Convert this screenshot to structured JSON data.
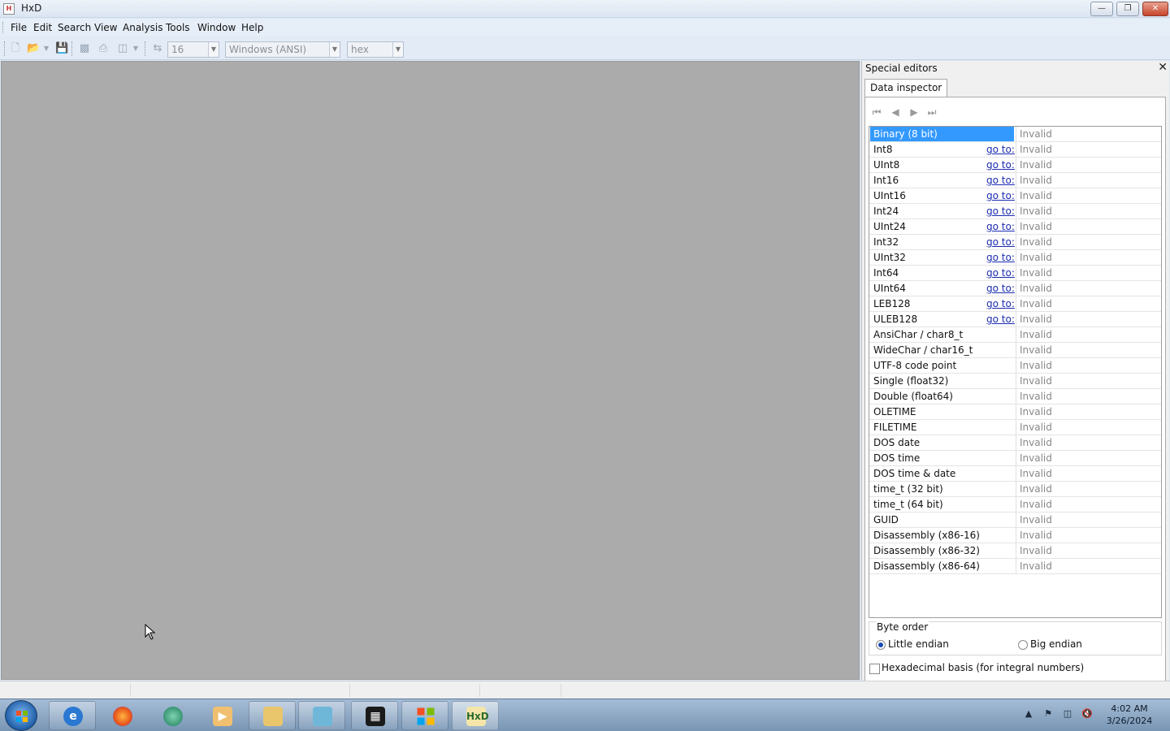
{
  "window": {
    "title": "HxD"
  },
  "menu": [
    "File",
    "Edit",
    "Search",
    "View",
    "Analysis",
    "Tools",
    "Window",
    "Help"
  ],
  "toolbar": {
    "bytes_per_row": "16",
    "charset": "Windows (ANSI)",
    "offset_base": "hex"
  },
  "panel": {
    "title": "Special editors",
    "tab": "Data inspector",
    "goto_label": "go to:",
    "rows": [
      {
        "name": "Binary (8 bit)",
        "value": "Invalid",
        "goto": false
      },
      {
        "name": "Int8",
        "value": "Invalid",
        "goto": true
      },
      {
        "name": "UInt8",
        "value": "Invalid",
        "goto": true
      },
      {
        "name": "Int16",
        "value": "Invalid",
        "goto": true
      },
      {
        "name": "UInt16",
        "value": "Invalid",
        "goto": true
      },
      {
        "name": "Int24",
        "value": "Invalid",
        "goto": true
      },
      {
        "name": "UInt24",
        "value": "Invalid",
        "goto": true
      },
      {
        "name": "Int32",
        "value": "Invalid",
        "goto": true
      },
      {
        "name": "UInt32",
        "value": "Invalid",
        "goto": true
      },
      {
        "name": "Int64",
        "value": "Invalid",
        "goto": true
      },
      {
        "name": "UInt64",
        "value": "Invalid",
        "goto": true
      },
      {
        "name": "LEB128",
        "value": "Invalid",
        "goto": true
      },
      {
        "name": "ULEB128",
        "value": "Invalid",
        "goto": true
      },
      {
        "name": "AnsiChar / char8_t",
        "value": "Invalid",
        "goto": false
      },
      {
        "name": "WideChar / char16_t",
        "value": "Invalid",
        "goto": false
      },
      {
        "name": "UTF-8 code point",
        "value": "Invalid",
        "goto": false
      },
      {
        "name": "Single (float32)",
        "value": "Invalid",
        "goto": false
      },
      {
        "name": "Double (float64)",
        "value": "Invalid",
        "goto": false
      },
      {
        "name": "OLETIME",
        "value": "Invalid",
        "goto": false
      },
      {
        "name": "FILETIME",
        "value": "Invalid",
        "goto": false
      },
      {
        "name": "DOS date",
        "value": "Invalid",
        "goto": false
      },
      {
        "name": "DOS time",
        "value": "Invalid",
        "goto": false
      },
      {
        "name": "DOS time & date",
        "value": "Invalid",
        "goto": false
      },
      {
        "name": "time_t (32 bit)",
        "value": "Invalid",
        "goto": false
      },
      {
        "name": "time_t (64 bit)",
        "value": "Invalid",
        "goto": false
      },
      {
        "name": "GUID",
        "value": "Invalid",
        "goto": false
      },
      {
        "name": "Disassembly (x86-16)",
        "value": "Invalid",
        "goto": false
      },
      {
        "name": "Disassembly (x86-32)",
        "value": "Invalid",
        "goto": false
      },
      {
        "name": "Disassembly (x86-64)",
        "value": "Invalid",
        "goto": false
      }
    ],
    "selected_row": "Binary (8 bit)",
    "byte_order": {
      "legend": "Byte order",
      "little": "Little endian",
      "big": "Big endian",
      "selected": "Little endian"
    },
    "hex_basis": {
      "label": "Hexadecimal basis (for integral numbers)",
      "checked": false
    }
  },
  "taskbar": {
    "apps": [
      "internet-explorer",
      "firefox",
      "chat-app",
      "media-player",
      "file-explorer",
      "notepad",
      "video-editor",
      "windows-app",
      "hxd"
    ],
    "time": "4:02 AM",
    "date": "3/26/2024"
  },
  "colors": {
    "selection": "#3399ff",
    "link": "#1a2bb0",
    "workspace": "#ababab"
  }
}
